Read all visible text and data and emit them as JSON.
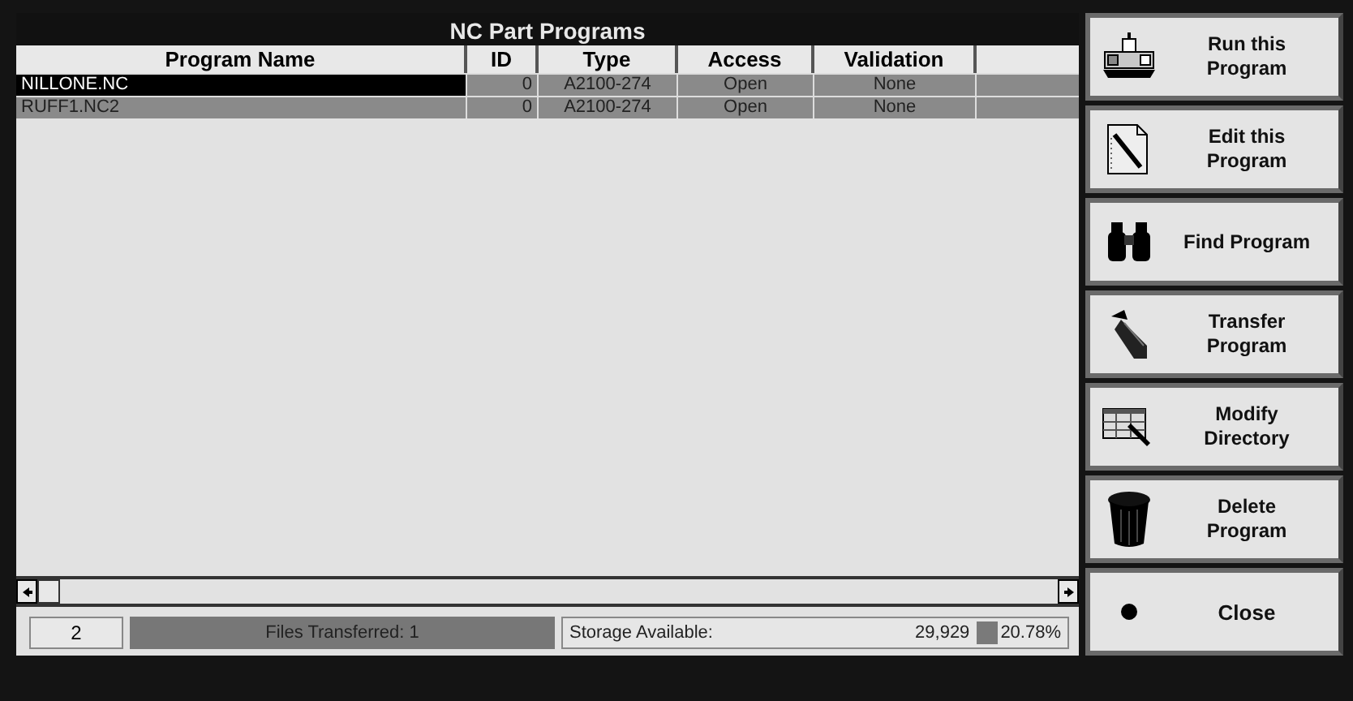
{
  "window": {
    "title": "NC Part Programs"
  },
  "table": {
    "columns": [
      "Program Name",
      "ID",
      "Type",
      "Access",
      "Validation"
    ],
    "rows": [
      {
        "cells": [
          "NILLONE.NC",
          "0",
          "A2100-274",
          "Open",
          "None"
        ],
        "selected": true
      },
      {
        "cells": [
          "RUFF1.NC2",
          "0",
          "A2100-274",
          "Open",
          "None"
        ],
        "selected": false
      }
    ]
  },
  "status_bar": {
    "count": "2",
    "transferred": "Files Transferred:  1",
    "storage_label": "Storage Available:",
    "storage_value": "29,929",
    "storage_percent": "20.78%"
  },
  "buttons": [
    {
      "kind": "run",
      "label": "Run this Program"
    },
    {
      "kind": "edit",
      "label": "Edit this Program"
    },
    {
      "kind": "find",
      "label": "Find Program"
    },
    {
      "kind": "transfer",
      "label": "Transfer Program"
    },
    {
      "kind": "modify",
      "label": "Modify Directory"
    },
    {
      "kind": "delete",
      "label": "Delete Program"
    },
    {
      "kind": "close",
      "label": "Close"
    }
  ]
}
